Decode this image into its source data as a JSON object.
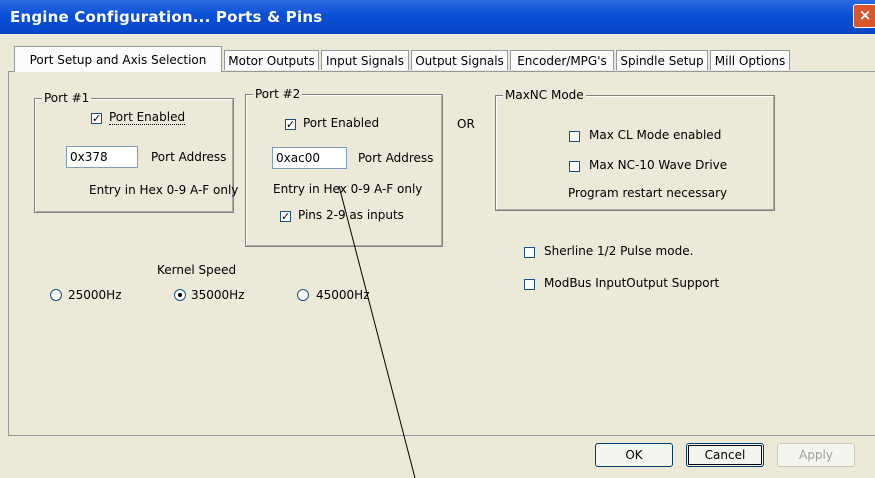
{
  "window": {
    "title": "Engine Configuration... Ports & Pins",
    "close_glyph": "×"
  },
  "tabs": [
    {
      "label": "Port Setup and Axis Selection",
      "active": true
    },
    {
      "label": "Motor Outputs"
    },
    {
      "label": "Input Signals"
    },
    {
      "label": "Output Signals"
    },
    {
      "label": "Encoder/MPG's"
    },
    {
      "label": "Spindle Setup"
    },
    {
      "label": "Mill Options"
    }
  ],
  "port1": {
    "legend": "Port #1",
    "enabled_label": "Port Enabled",
    "enabled": true,
    "address_value": "0x378",
    "address_label": "Port Address",
    "hex_note": "Entry in Hex 0-9 A-F only"
  },
  "port2": {
    "legend": "Port #2",
    "enabled_label": "Port Enabled",
    "enabled": true,
    "address_value": "0xac00",
    "address_label": "Port Address",
    "hex_note": "Entry in Hex 0-9 A-F only",
    "pins_label": "Pins 2-9 as inputs",
    "pins_checked": true
  },
  "or_label": "OR",
  "maxnc": {
    "legend": "MaxNC Mode",
    "cl_label": "Max CL Mode enabled",
    "wave_label": "Max NC-10 Wave Drive",
    "restart_note": "Program restart necessary"
  },
  "sherline_label": "Sherline 1/2 Pulse mode.",
  "modbus_label": "ModBus InputOutput Support",
  "kernel": {
    "title": "Kernel Speed",
    "options": [
      "25000Hz",
      "35000Hz",
      "45000Hz"
    ],
    "selected": "35000Hz"
  },
  "buttons": {
    "ok": "OK",
    "cancel": "Cancel",
    "apply": "Apply"
  }
}
